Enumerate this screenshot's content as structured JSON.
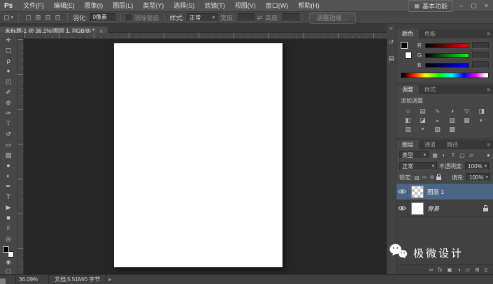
{
  "menubar": {
    "logo": "Ps",
    "menus": [
      {
        "label": "文件(F)"
      },
      {
        "label": "编辑(E)"
      },
      {
        "label": "图像(I)"
      },
      {
        "label": "图层(L)"
      },
      {
        "label": "类型(Y)"
      },
      {
        "label": "选择(S)"
      },
      {
        "label": "滤镜(T)"
      },
      {
        "label": "视图(V)"
      },
      {
        "label": "窗口(W)"
      },
      {
        "label": "帮助(H)"
      }
    ],
    "workspace_icon": "▦",
    "workspace": "基本功能",
    "min": "–",
    "restore": "▢",
    "close": "×"
  },
  "options": {
    "preset_glyph": "▢",
    "preset_caret": "▾",
    "modes": [
      {
        "name": "new-selection-mode-icon",
        "glyph": "▢"
      },
      {
        "name": "add-to-selection-mode-icon",
        "glyph": "⊞"
      },
      {
        "name": "subtract-from-selection-mode-icon",
        "glyph": "⊟"
      },
      {
        "name": "intersect-selection-mode-icon",
        "glyph": "⊡"
      }
    ],
    "feather_label": "羽化:",
    "feather_value": "0像素",
    "antialias_label": "消除锯齿",
    "style_label": "样式:",
    "style_value": "正常",
    "dd_caret": "▾",
    "width_label": "宽度:",
    "swap_glyph": "⇄",
    "height_label": "高度:",
    "refine_edge_label": "调整边缘…"
  },
  "tab": {
    "title": "未标题-1 @ 36.1%(图层 1, RGB/8) *",
    "close": "×"
  },
  "tools": [
    {
      "name": "move-tool",
      "glyph": "✛"
    },
    {
      "name": "rectangular-marquee-tool",
      "glyph": "▢"
    },
    {
      "name": "lasso-tool",
      "glyph": "ρ"
    },
    {
      "name": "quick-selection-tool",
      "glyph": "✦"
    },
    {
      "name": "crop-tool",
      "glyph": "◰"
    },
    {
      "name": "eyedropper-tool",
      "glyph": "✐"
    },
    {
      "name": "spot-healing-brush-tool",
      "glyph": "⊕"
    },
    {
      "name": "brush-tool",
      "glyph": "✑"
    },
    {
      "name": "clone-stamp-tool",
      "glyph": "⊤"
    },
    {
      "name": "history-brush-tool",
      "glyph": "↺"
    },
    {
      "name": "eraser-tool",
      "glyph": "▭"
    },
    {
      "name": "gradient-tool",
      "glyph": "▧"
    },
    {
      "name": "blur-tool",
      "glyph": "●"
    },
    {
      "name": "dodge-tool",
      "glyph": "◐"
    },
    {
      "name": "pen-tool",
      "glyph": "✒"
    },
    {
      "name": "horizontal-type-tool",
      "glyph": "T"
    },
    {
      "name": "path-selection-tool",
      "glyph": "▶"
    },
    {
      "name": "rectangle-tool",
      "glyph": "■"
    },
    {
      "name": "hand-tool",
      "glyph": "✌"
    },
    {
      "name": "zoom-tool",
      "glyph": "◎"
    }
  ],
  "toolbar_bottom": {
    "quick_mask_glyph": "◉",
    "screen_mode_glyph": "▢"
  },
  "dock_strip": {
    "collapse_glyph": "«",
    "icons": [
      {
        "name": "history-panel-button",
        "glyph": "↺"
      },
      {
        "name": "properties-panel-button",
        "glyph": "▤"
      }
    ]
  },
  "color_panel": {
    "tab_color": "颜色",
    "tab_swatches": "色板",
    "menu_glyph": "≡",
    "sliders": [
      {
        "label": "R",
        "color": "#ff0000"
      },
      {
        "label": "G",
        "color": "#00ff00"
      },
      {
        "label": "B",
        "color": "#0000ff"
      }
    ]
  },
  "adjustments_panel": {
    "tab_adjustments": "调整",
    "tab_styles": "样式",
    "menu_glyph": "≡",
    "title": "添加调整",
    "icons": [
      {
        "name": "brightness-contrast-adjustment-icon",
        "glyph": "☼"
      },
      {
        "name": "levels-adjustment-icon",
        "glyph": "▤"
      },
      {
        "name": "curves-adjustment-icon",
        "glyph": "∿"
      },
      {
        "name": "exposure-adjustment-icon",
        "glyph": "◑"
      },
      {
        "name": "vibrance-adjustment-icon",
        "glyph": "▽"
      },
      {
        "name": "hue-saturation-adjustment-icon",
        "glyph": "◨"
      },
      {
        "name": "color-balance-adjustment-icon",
        "glyph": "◧"
      },
      {
        "name": "black-white-adjustment-icon",
        "glyph": "◪"
      },
      {
        "name": "photo-filter-adjustment-icon",
        "glyph": "◒"
      },
      {
        "name": "channel-mixer-adjustment-icon",
        "glyph": "▥"
      },
      {
        "name": "color-lookup-adjustment-icon",
        "glyph": "▦"
      },
      {
        "name": "invert-adjustment-icon",
        "glyph": "◐"
      },
      {
        "name": "posterize-adjustment-icon",
        "glyph": "▨"
      },
      {
        "name": "threshold-adjustment-icon",
        "glyph": "◓"
      },
      {
        "name": "gradient-map-adjustment-icon",
        "glyph": "▧"
      },
      {
        "name": "selective-color-adjustment-icon",
        "glyph": "▩"
      }
    ]
  },
  "layers_panel": {
    "tab_layers": "图层",
    "tab_channels": "通道",
    "tab_paths": "路径",
    "menu_glyph": "≡",
    "filter_label": "类型",
    "filter_caret": "▾",
    "filter_icons": [
      {
        "name": "pixel-layer-filter-icon",
        "glyph": "▦"
      },
      {
        "name": "adjustment-layer-filter-icon",
        "glyph": "◐"
      },
      {
        "name": "type-layer-filter-icon",
        "glyph": "T"
      },
      {
        "name": "shape-layer-filter-icon",
        "glyph": "▢"
      },
      {
        "name": "smart-object-filter-icon",
        "glyph": "▱"
      }
    ],
    "filter_toggle_glyph": "●",
    "blend_mode": "正常",
    "opacity_label": "不透明度:",
    "opacity_value": "100%",
    "lock_label": "锁定:",
    "lock_icons": [
      {
        "name": "lock-transparency-icon",
        "glyph": "▨"
      },
      {
        "name": "lock-pixels-icon",
        "glyph": "✑"
      },
      {
        "name": "lock-position-icon",
        "glyph": "✛"
      }
    ],
    "fill_label": "填充:",
    "fill_value": "100%",
    "layers": [
      {
        "name": "图层 1"
      },
      {
        "name": "背景"
      }
    ],
    "buttons": [
      {
        "name": "link-layers-button",
        "glyph": "∞"
      },
      {
        "name": "layer-effects-button",
        "glyph": "fx"
      },
      {
        "name": "add-layer-mask-button",
        "glyph": "▣"
      },
      {
        "name": "new-adjustment-layer-button",
        "glyph": "◑"
      },
      {
        "name": "new-group-button",
        "glyph": "▱"
      },
      {
        "name": "new-layer-button",
        "glyph": "⊞"
      },
      {
        "name": "delete-layer-button",
        "glyph": "▯"
      }
    ]
  },
  "status": {
    "zoom": "36.09%",
    "doc": "文档:5.51M/0 字节",
    "expand_glyph": "▸"
  },
  "watermark": {
    "text": "极微设计"
  },
  "colors": {
    "selected_layer": "#4b6685",
    "canvas_background": "#262626",
    "panel_background": "#474747",
    "document_background": "#ffffff"
  }
}
